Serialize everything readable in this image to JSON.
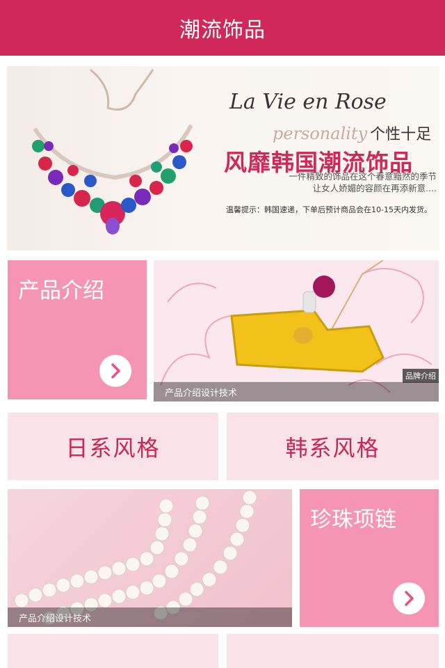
{
  "header": {
    "title": "潮流饰品"
  },
  "banner": {
    "title": "La Vie en Rose",
    "tagline_en": "personality",
    "tagline_cn": "个性十足",
    "headline": "风靡韩国潮流饰品",
    "copy_line1": "一件精致的饰品在这个春意黯然的季节",
    "copy_line2": "让女人娇媚的容颜在再添新意....",
    "notice": "温馨提示：韩国速递，下单后预计商品会在10-15天内发货。"
  },
  "tiles": {
    "product_intro": {
      "label": "产品介绍"
    },
    "product_photo": {
      "caption": "产品介绍设计技术",
      "side_tag": "品牌介绍"
    },
    "japanese_style": {
      "label": "日系风格"
    },
    "korean_style": {
      "label": "韩系风格"
    },
    "pearl_photo": {
      "caption": "产品介绍设计技术"
    },
    "pearl_necklace": {
      "label": "珍珠项链"
    }
  },
  "icons": {
    "arrow": "chevron-right-icon"
  },
  "colors": {
    "accent": "#d0285a",
    "tile_pink": "#f595b3",
    "tile_light": "#f9e3e8",
    "tile_text": "#cc2458"
  }
}
